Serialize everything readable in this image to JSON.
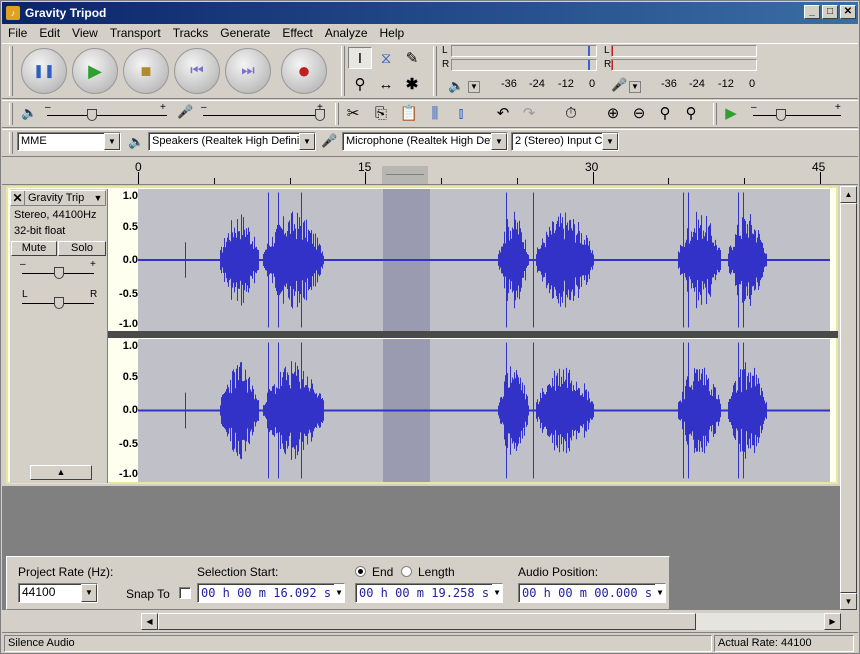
{
  "window": {
    "title": "Gravity Tripod"
  },
  "menu": [
    "File",
    "Edit",
    "View",
    "Transport",
    "Tracks",
    "Generate",
    "Effect",
    "Analyze",
    "Help"
  ],
  "transport": [
    {
      "name": "pause",
      "glyph": "❚❚",
      "color": "#2f5fbf"
    },
    {
      "name": "play",
      "glyph": "▶",
      "color": "#2f9f2f"
    },
    {
      "name": "stop",
      "glyph": "■",
      "color": "#b08a30"
    },
    {
      "name": "skip-start",
      "glyph": "⏮",
      "color": "#7b6fd0"
    },
    {
      "name": "skip-end",
      "glyph": "⏭",
      "color": "#7b6fd0"
    },
    {
      "name": "record",
      "glyph": "●",
      "color": "#c02020"
    }
  ],
  "meters": {
    "playback": {
      "L": "L",
      "R": "R",
      "scale": [
        "-36",
        "-24",
        "-12",
        "0"
      ]
    },
    "record": {
      "L": "L",
      "R": "R",
      "scale": [
        "-36",
        "-24",
        "-12",
        "0"
      ]
    }
  },
  "devices": {
    "host": "MME",
    "output": "Speakers (Realtek High Definiti",
    "input": "Microphone (Realtek High Defi",
    "channels": "2 (Stereo) Input C"
  },
  "ruler": {
    "labels": [
      "0",
      "15",
      "30",
      "45"
    ]
  },
  "track": {
    "name": "Gravity Trip",
    "info1": "Stereo, 44100Hz",
    "info2": "32-bit float",
    "mute": "Mute",
    "solo": "Solo",
    "gain_minus": "–",
    "gain_plus": "+",
    "pan_left": "L",
    "pan_right": "R",
    "scale": [
      "1.0",
      "0.5",
      "0.0",
      "-0.5",
      "-1.0"
    ]
  },
  "selection_bar": {
    "project_rate_label": "Project Rate (Hz):",
    "project_rate": "44100",
    "snap_to": "Snap To",
    "selection_start_label": "Selection Start:",
    "end_label": "End",
    "length_label": "Length",
    "audio_position_label": "Audio Position:",
    "start_time": "00 h 00 m 16.092 s",
    "end_time": "00 h 00 m 19.258 s",
    "audio_position": "00 h 00 m 00.000 s"
  },
  "status": {
    "left": "Silence Audio",
    "right": "Actual Rate: 44100"
  }
}
